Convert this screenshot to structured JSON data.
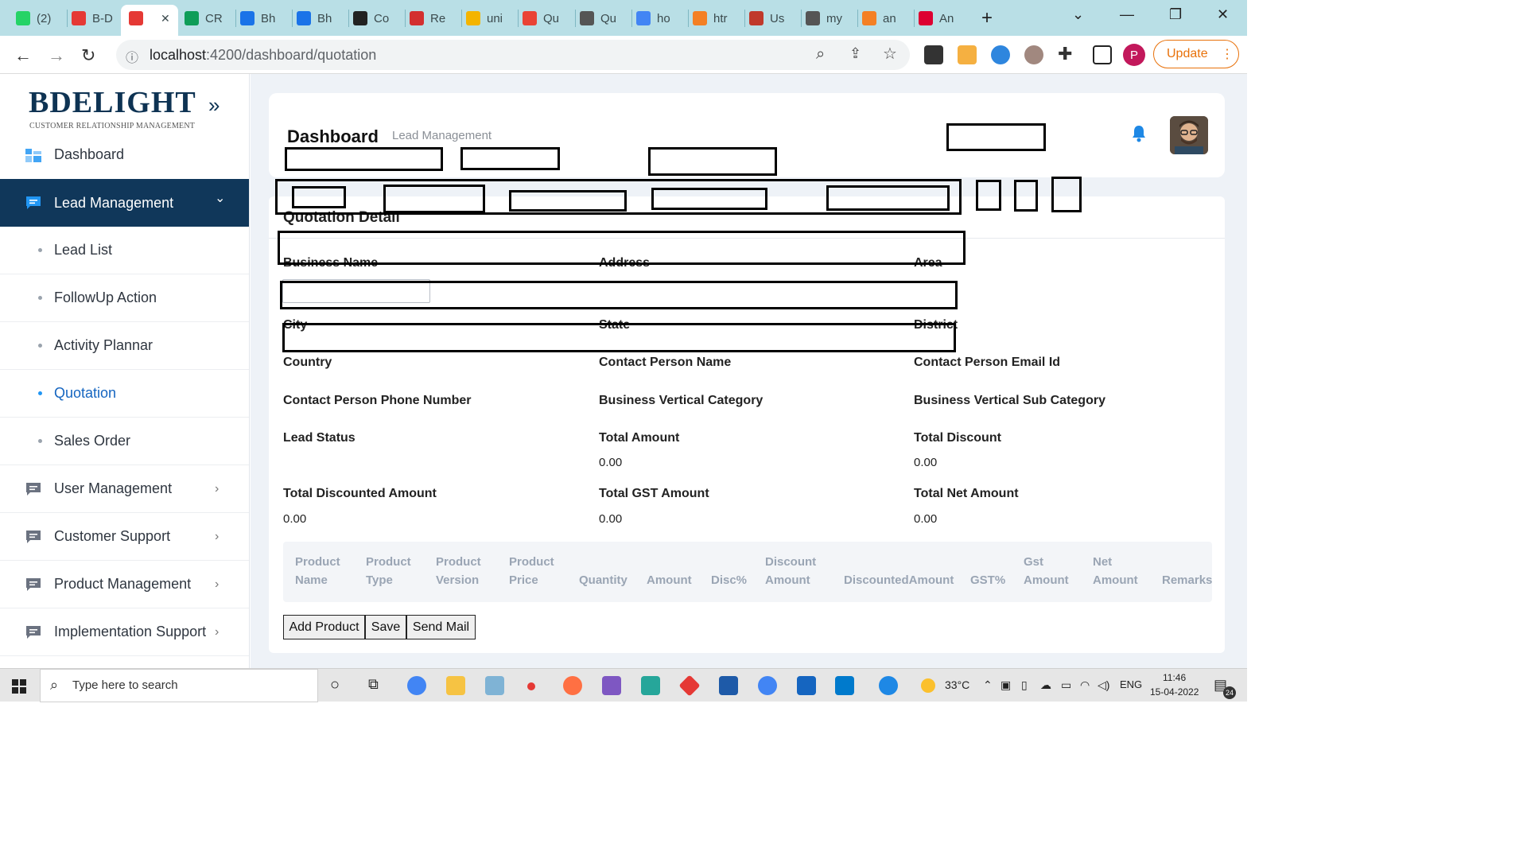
{
  "browser": {
    "tabs": [
      {
        "title": "(2)",
        "icon": "whatsapp-icon",
        "color": "#25d366"
      },
      {
        "title": "B-D",
        "icon": "angular-icon",
        "color": "#e53935"
      },
      {
        "title": "",
        "icon": "angular-icon",
        "color": "#e53935"
      },
      {
        "title": "CR",
        "icon": "sheets-icon",
        "color": "#0f9d58"
      },
      {
        "title": "Bh",
        "icon": "chart-icon",
        "color": "#1a73e8"
      },
      {
        "title": "Bh",
        "icon": "chart-icon",
        "color": "#1a73e8"
      },
      {
        "title": "Co",
        "icon": "github-icon",
        "color": "#222222"
      },
      {
        "title": "Re",
        "icon": "r-icon",
        "color": "#d32f2f"
      },
      {
        "title": "uni",
        "icon": "drive-icon",
        "color": "#f4b400"
      },
      {
        "title": "Qu",
        "icon": "gmail-icon",
        "color": "#ea4335"
      },
      {
        "title": "Qu",
        "icon": "globe-icon",
        "color": "#555555"
      },
      {
        "title": "ho",
        "icon": "google-icon",
        "color": "#4285f4"
      },
      {
        "title": "htr",
        "icon": "stackoverflow-icon",
        "color": "#f48024"
      },
      {
        "title": "Us",
        "icon": "bug-icon",
        "color": "#c0392b"
      },
      {
        "title": "my",
        "icon": "globe-icon",
        "color": "#555555"
      },
      {
        "title": "an",
        "icon": "stackoverflow-icon",
        "color": "#f48024"
      },
      {
        "title": "An",
        "icon": "angular-icon",
        "color": "#dd0031"
      }
    ],
    "close_glyph": "✕",
    "new_tab_glyph": "+",
    "url_host": "localhost",
    "url_path": ":4200/dashboard/quotation",
    "profile_letter": "P",
    "update_label": "Update"
  },
  "sidebar": {
    "logo_text": "BDELIGHT",
    "logo_sub": "CUSTOMER RELATIONSHIP MANAGEMENT",
    "toggle_glyph": "»",
    "items": [
      {
        "label": "Dashboard"
      },
      {
        "label": "Lead Management"
      },
      {
        "label": "Lead List"
      },
      {
        "label": "FollowUp Action"
      },
      {
        "label": "Activity Plannar"
      },
      {
        "label": "Quotation"
      },
      {
        "label": "Sales Order"
      },
      {
        "label": "User Management"
      },
      {
        "label": "Customer Support"
      },
      {
        "label": "Product Management"
      },
      {
        "label": "Implementation Support"
      }
    ],
    "chevron_right": "›",
    "chevron_down": "⌄"
  },
  "header": {
    "title": "Dashboard",
    "breadcrumb": "Lead Management"
  },
  "quotation": {
    "section_title": "Quotation Detail",
    "fields": {
      "business_name": "Business Name",
      "address": "Address",
      "area": "Area",
      "city": "City",
      "state": "State",
      "district": "District",
      "country": "Country",
      "contact_person_name": "Contact Person Name",
      "contact_person_email": "Contact Person Email Id",
      "contact_person_phone": "Contact Person Phone Number",
      "business_vertical_category": "Business Vertical Category",
      "business_vertical_sub_category": "Business Vertical Sub Category",
      "lead_status": "Lead Status",
      "total_amount": "Total Amount",
      "total_discount": "Total Discount",
      "total_discounted_amount": "Total Discounted Amount",
      "total_gst_amount": "Total GST Amount",
      "total_net_amount": "Total Net Amount"
    },
    "values": {
      "total_amount": "0.00",
      "total_discount": "0.00",
      "total_discounted_amount": "0.00",
      "total_gst_amount": "0.00",
      "total_net_amount": "0.00"
    },
    "table_headers": [
      [
        "Product",
        "Name"
      ],
      [
        "Product",
        "Type"
      ],
      [
        "Product",
        "Version"
      ],
      [
        "Product",
        "Price"
      ],
      [
        "",
        "Quantity"
      ],
      [
        "",
        "Amount"
      ],
      [
        "",
        "Disc%"
      ],
      [
        "Discount",
        "Amount"
      ],
      [
        "",
        "DiscountedAmount"
      ],
      [
        "",
        "GST%"
      ],
      [
        "Gst",
        "Amount"
      ],
      [
        "Net",
        "Amount"
      ],
      [
        "",
        "Remarks"
      ]
    ],
    "buttons": {
      "add_product": "Add Product",
      "save": "Save",
      "send_mail": "Send Mail"
    }
  },
  "taskbar": {
    "search_placeholder": "Type here to search",
    "weather": "33°C",
    "language": "ENG",
    "time": "11:46",
    "date": "15-04-2022",
    "notification_count": "24"
  }
}
